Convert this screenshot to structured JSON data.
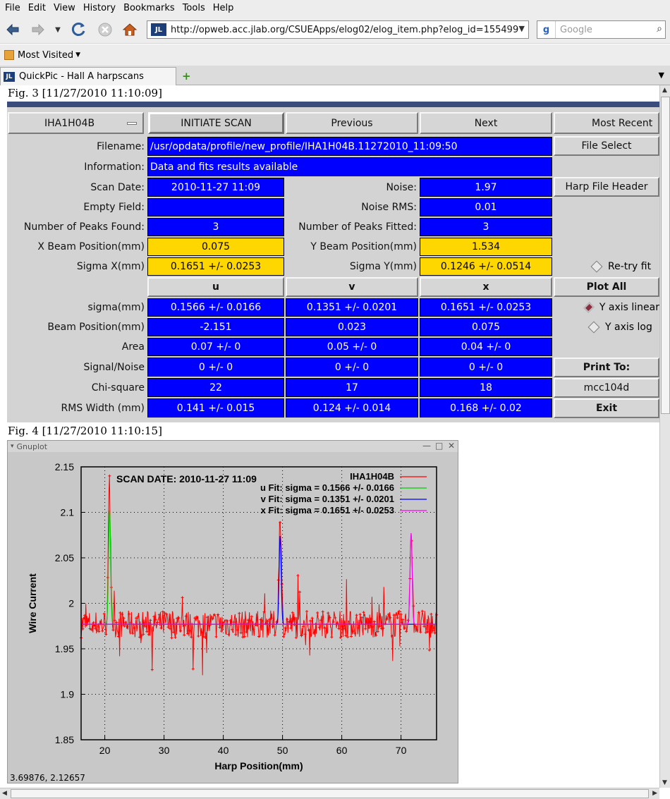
{
  "browser": {
    "menu": [
      "File",
      "Edit",
      "View",
      "History",
      "Bookmarks",
      "Tools",
      "Help"
    ],
    "url": "http://opweb.acc.jlab.org/CSUEApps/elog02/elog_item.php?elog_id=155499",
    "site_badge": "JL",
    "search_placeholder": "Google",
    "search_engine_glyph": "g",
    "bookmarks_label": "Most Visited",
    "tab_title": "QuickPic - Hall A harpscans",
    "new_tab_glyph": "+"
  },
  "fig3": {
    "caption": "Fig. 3 [11/27/2010 11:10:09]",
    "harp_select": "IHA1H04B",
    "buttons": {
      "initiate": "INITIATE SCAN",
      "previous": "Previous",
      "next": "Next",
      "most_recent": "Most Recent",
      "file_select": "File Select",
      "harp_header": "Harp File Header",
      "plot_all": "Plot All",
      "print_to": "Print To:",
      "printer": "mcc104d",
      "exit": "Exit"
    },
    "radios": {
      "retry": "Re-try fit",
      "y_linear": "Y axis linear",
      "y_log": "Y axis log"
    },
    "filename_label": "Filename:",
    "filename": "/usr/opdata/profile/new_profile/IHA1H04B.11272010_11:09:50",
    "info_label": "Information:",
    "info": "Data and fits results available",
    "scan_date_label": "Scan Date:",
    "scan_date": "2010-11-27   11:09",
    "noise_label": "Noise:",
    "noise": "1.97",
    "empty_label": "Empty Field:",
    "empty": "",
    "noise_rms_label": "Noise RMS:",
    "noise_rms": "0.01",
    "peaks_found_label": "Number of Peaks Found:",
    "peaks_found": "3",
    "peaks_fitted_label": "Number of Peaks Fitted:",
    "peaks_fitted": "3",
    "xbeam_label": "X Beam Position(mm)",
    "xbeam": "0.075",
    "ybeam_label": "Y Beam Position(mm)",
    "ybeam": "1.534",
    "sigx_label": "Sigma X(mm)",
    "sigx": "0.1651 +/- 0.0253",
    "sigy_label": "Sigma Y(mm)",
    "sigy": "0.1246 +/- 0.0514",
    "columns": [
      "u",
      "v",
      "x"
    ],
    "rows": [
      {
        "label": "sigma(mm)",
        "u": "0.1566 +/- 0.0166",
        "v": "0.1351 +/- 0.0201",
        "x": "0.1651 +/- 0.0253"
      },
      {
        "label": "Beam Position(mm)",
        "u": "-2.151",
        "v": "0.023",
        "x": "0.075"
      },
      {
        "label": "Area",
        "u": "0.07 +/- 0",
        "v": "0.05 +/- 0",
        "x": "0.04 +/- 0"
      },
      {
        "label": "Signal/Noise",
        "u": "0 +/- 0",
        "v": "0 +/- 0",
        "x": "0 +/- 0"
      },
      {
        "label": "Chi-square",
        "u": "22",
        "v": "17",
        "x": "18"
      },
      {
        "label": "RMS Width (mm)",
        "u": "0.141 +/- 0.015",
        "v": "0.124 +/- 0.014",
        "x": "0.168 +/- 0.02"
      }
    ]
  },
  "fig4": {
    "caption": "Fig. 4 [11/27/2010 11:10:15]",
    "window_title": "Gnuplot",
    "window_buttons": [
      "—",
      "□",
      "✕"
    ],
    "coords": "3.69876, 2.12657"
  },
  "chart_data": {
    "type": "line",
    "annotation": "SCAN DATE: 2010-11-27    11:09",
    "xlabel": "Harp Position(mm)",
    "ylabel": "Wire Current",
    "xlim": [
      16,
      76
    ],
    "ylim": [
      1.85,
      2.15
    ],
    "xticks": [
      20,
      30,
      40,
      50,
      60,
      70
    ],
    "yticks": [
      1.85,
      1.9,
      1.95,
      2.0,
      2.05,
      2.1,
      2.15
    ],
    "ytick_labels": [
      "1.85",
      "1.9",
      "1.95",
      "2",
      "2.05",
      "2.1",
      "2.15"
    ],
    "grid": true,
    "legend_position": "top-right",
    "baseline": 1.977,
    "series": [
      {
        "name": "IHA1H04B",
        "color": "#ff0000",
        "type": "noisy-data",
        "peaks": [
          {
            "x": 20.8,
            "y": 2.13
          },
          {
            "x": 49.6,
            "y": 2.1
          },
          {
            "x": 71.7,
            "y": 2.08
          }
        ]
      },
      {
        "name": "u  Fit: sigma = 0.1566 +/- 0.0166",
        "color": "#00cc00",
        "center": 20.8,
        "amplitude": 0.125
      },
      {
        "name": "v  Fit: sigma = 0.1351 +/- 0.0201",
        "color": "#0000ff",
        "center": 49.6,
        "amplitude": 0.097
      },
      {
        "name": "x  Fit: sigma = 0.1651 +/- 0.0253",
        "color": "#ff00ff",
        "center": 71.7,
        "amplitude": 0.1
      }
    ]
  }
}
